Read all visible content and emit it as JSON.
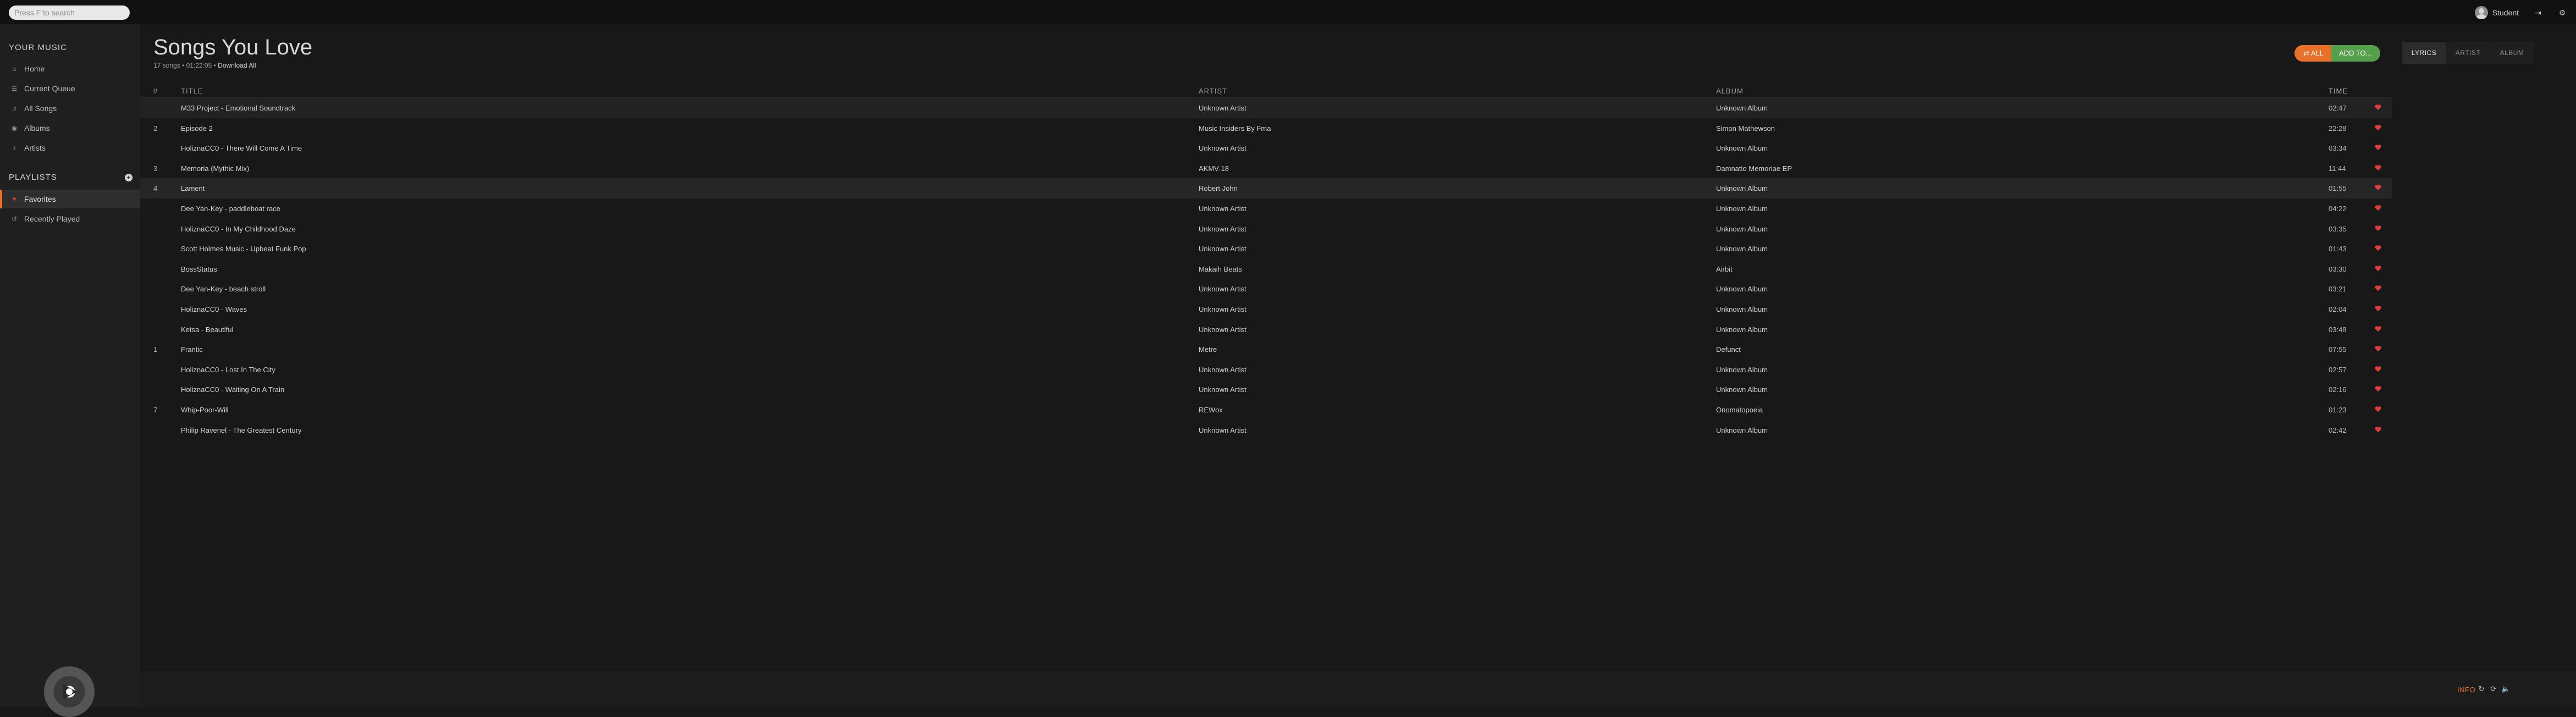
{
  "search": {
    "placeholder": "Press F to search"
  },
  "user": {
    "name": "Student"
  },
  "sidebar": {
    "your_music_heading": "YOUR MUSIC",
    "items": [
      {
        "label": "Home",
        "icon": "home-icon"
      },
      {
        "label": "Current Queue",
        "icon": "queue-icon"
      },
      {
        "label": "All Songs",
        "icon": "music-note-icon"
      },
      {
        "label": "Albums",
        "icon": "album-icon"
      },
      {
        "label": "Artists",
        "icon": "microphone-icon"
      }
    ],
    "playlists_heading": "PLAYLISTS",
    "playlists": [
      {
        "label": "Favorites",
        "icon": "heart-icon",
        "active": true
      },
      {
        "label": "Recently Played",
        "icon": "history-icon",
        "active": false
      }
    ]
  },
  "main": {
    "title": "Songs You Love",
    "meta_summary": "17 songs • 01:22:05 •",
    "download_all": "Download All",
    "shuffle_all_label": "ALL",
    "add_to_label": "ADD TO...",
    "tabs": [
      "LYRICS",
      "ARTIST",
      "ALBUM"
    ],
    "active_tab": "LYRICS",
    "columns": {
      "num": "#",
      "title": "TITLE",
      "artist": "ARTIST",
      "album": "ALBUM",
      "time": "TIME"
    },
    "songs": [
      {
        "num": "",
        "title": "M33 Project - Emotional Soundtrack",
        "artist": "Unknown Artist",
        "album": "Unknown Album",
        "time": "02:47"
      },
      {
        "num": "2",
        "title": "Episode 2",
        "artist": "Music Insiders By Fma",
        "album": "Simon Mathewson",
        "time": "22:28"
      },
      {
        "num": "",
        "title": "HoliznaCC0 - There Will Come A Time",
        "artist": "Unknown Artist",
        "album": "Unknown Album",
        "time": "03:34"
      },
      {
        "num": "3",
        "title": "Memoria (Mythic Mix)",
        "artist": "AKMV-18",
        "album": "Damnatio Memoriae EP",
        "time": "11:44"
      },
      {
        "num": "4",
        "title": "Lament",
        "artist": "Robert John",
        "album": "Unknown Album",
        "time": "01:55"
      },
      {
        "num": "",
        "title": "Dee Yan-Key - paddleboat race",
        "artist": "Unknown Artist",
        "album": "Unknown Album",
        "time": "04:22"
      },
      {
        "num": "",
        "title": "HoliznaCC0 - In My Childhood Daze",
        "artist": "Unknown Artist",
        "album": "Unknown Album",
        "time": "03:35"
      },
      {
        "num": "",
        "title": "Scott Holmes Music - Upbeat Funk Pop",
        "artist": "Unknown Artist",
        "album": "Unknown Album",
        "time": "01:43"
      },
      {
        "num": "",
        "title": "BossStatus",
        "artist": "Makaih Beats",
        "album": "Airbit",
        "time": "03:30"
      },
      {
        "num": "",
        "title": "Dee Yan-Key - beach stroll",
        "artist": "Unknown Artist",
        "album": "Unknown Album",
        "time": "03:21"
      },
      {
        "num": "",
        "title": "HoliznaCC0 - Waves",
        "artist": "Unknown Artist",
        "album": "Unknown Album",
        "time": "02:04"
      },
      {
        "num": "",
        "title": "Ketsa - Beautiful",
        "artist": "Unknown Artist",
        "album": "Unknown Album",
        "time": "03:48"
      },
      {
        "num": "1",
        "title": "Frantic",
        "artist": "Metre",
        "album": "Defunct",
        "time": "07:55"
      },
      {
        "num": "",
        "title": "HoliznaCC0 - Lost In The City",
        "artist": "Unknown Artist",
        "album": "Unknown Album",
        "time": "02:57"
      },
      {
        "num": "",
        "title": "HoliznaCC0 - Waiting On A Train",
        "artist": "Unknown Artist",
        "album": "Unknown Album",
        "time": "02:16"
      },
      {
        "num": "7",
        "title": "Whip-Poor-Will",
        "artist": "REWox",
        "album": "Onomatopoeia",
        "time": "01:23"
      },
      {
        "num": "",
        "title": "Philip Ravenel - The Greatest Century",
        "artist": "Unknown Artist",
        "album": "Unknown Album",
        "time": "02:42"
      }
    ]
  },
  "footer": {
    "info_label": "INFO"
  },
  "colors": {
    "accent": "#e8702a",
    "add_green": "#55a04a",
    "heart": "#e03c3c",
    "background": "#181818"
  }
}
